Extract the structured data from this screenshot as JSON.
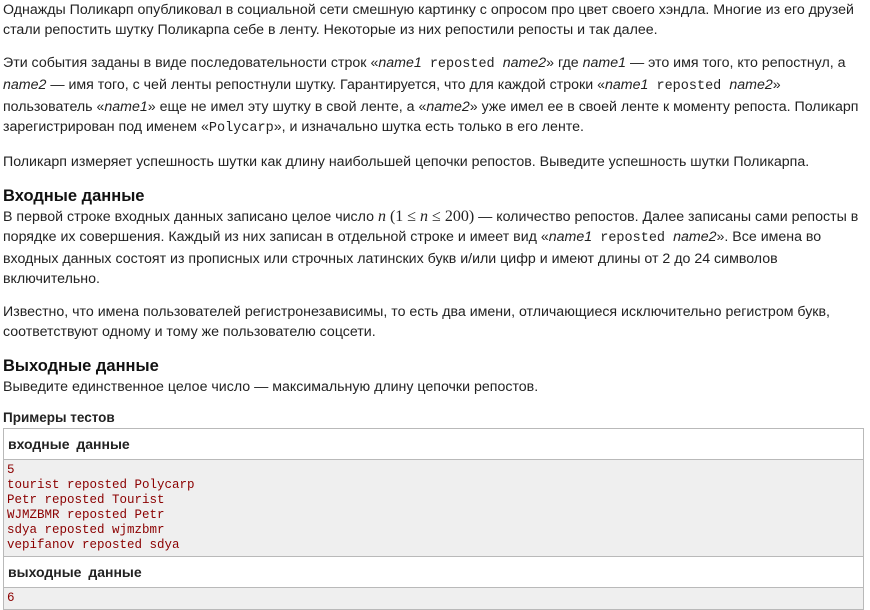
{
  "statement": {
    "p1": "Однажды Поликарп опубликовал в социальной сети смешную картинку с опросом про цвет своего хэндла. Многие из его друзей стали репостить шутку Поликарпа себе в ленту. Некоторые из них репостили репосты и так далее.",
    "p2": {
      "t1": "Эти события заданы в виде последовательности строк «",
      "name1": "name1",
      "reposted": " reposted ",
      "name2": "name2",
      "t2": "» где ",
      "t3": " — это имя того, кто репостнул, а ",
      "t4": " — имя того, с чей ленты репостнули шутку. Гарантируется, что для каждой строки «",
      "t5": "» пользователь «",
      "t6": "» еще не имел эту шутку в свой ленте, а «",
      "t7": "» уже имел ее в своей ленте к моменту репоста. Поликарп зарегистрирован под именем «",
      "polycarp": "Polycarp",
      "t8": "», и изначально шутка есть только в его ленте."
    },
    "p3": "Поликарп измеряет успешность шутки как длину наибольшей цепочки репостов. Выведите успешность шутки Поликарпа."
  },
  "input_section": {
    "title": "Входные данные",
    "p1": {
      "t1": "В первой строке входных данных записано целое число ",
      "n": "n",
      "open": " (1 ≤ ",
      "n2": "n",
      "close": " ≤ 200)",
      "t2": " — количество репостов. Далее записаны сами репосты в порядке их совершения. Каждый из них записан в отдельной строке и имеет вид «",
      "name1": "name1",
      "reposted": " reposted ",
      "name2": "name2",
      "t3": "». Все имена во входных данных состоят из прописных или строчных латинских букв и/или цифр и имеют длины от 2 до 24 символов включительно."
    },
    "p2": "Известно, что имена пользователей регистронезависимы, то есть два имени, отличающиеся исключительно регистром букв, соответствуют одному и тому же пользователю соцсети."
  },
  "output_section": {
    "title": "Выходные данные",
    "p1": "Выведите единственное целое число — максимальную длину цепочки репостов."
  },
  "examples": {
    "title": "Примеры тестов",
    "input_header": "входные данные",
    "input_lines": [
      "5",
      "tourist reposted Polycarp",
      "Petr reposted Tourist",
      "WJMZBMR reposted Petr",
      "sdya reposted wjmzbmr",
      "vepifanov reposted sdya"
    ],
    "output_header": "выходные данные",
    "output_lines": [
      "6"
    ]
  }
}
